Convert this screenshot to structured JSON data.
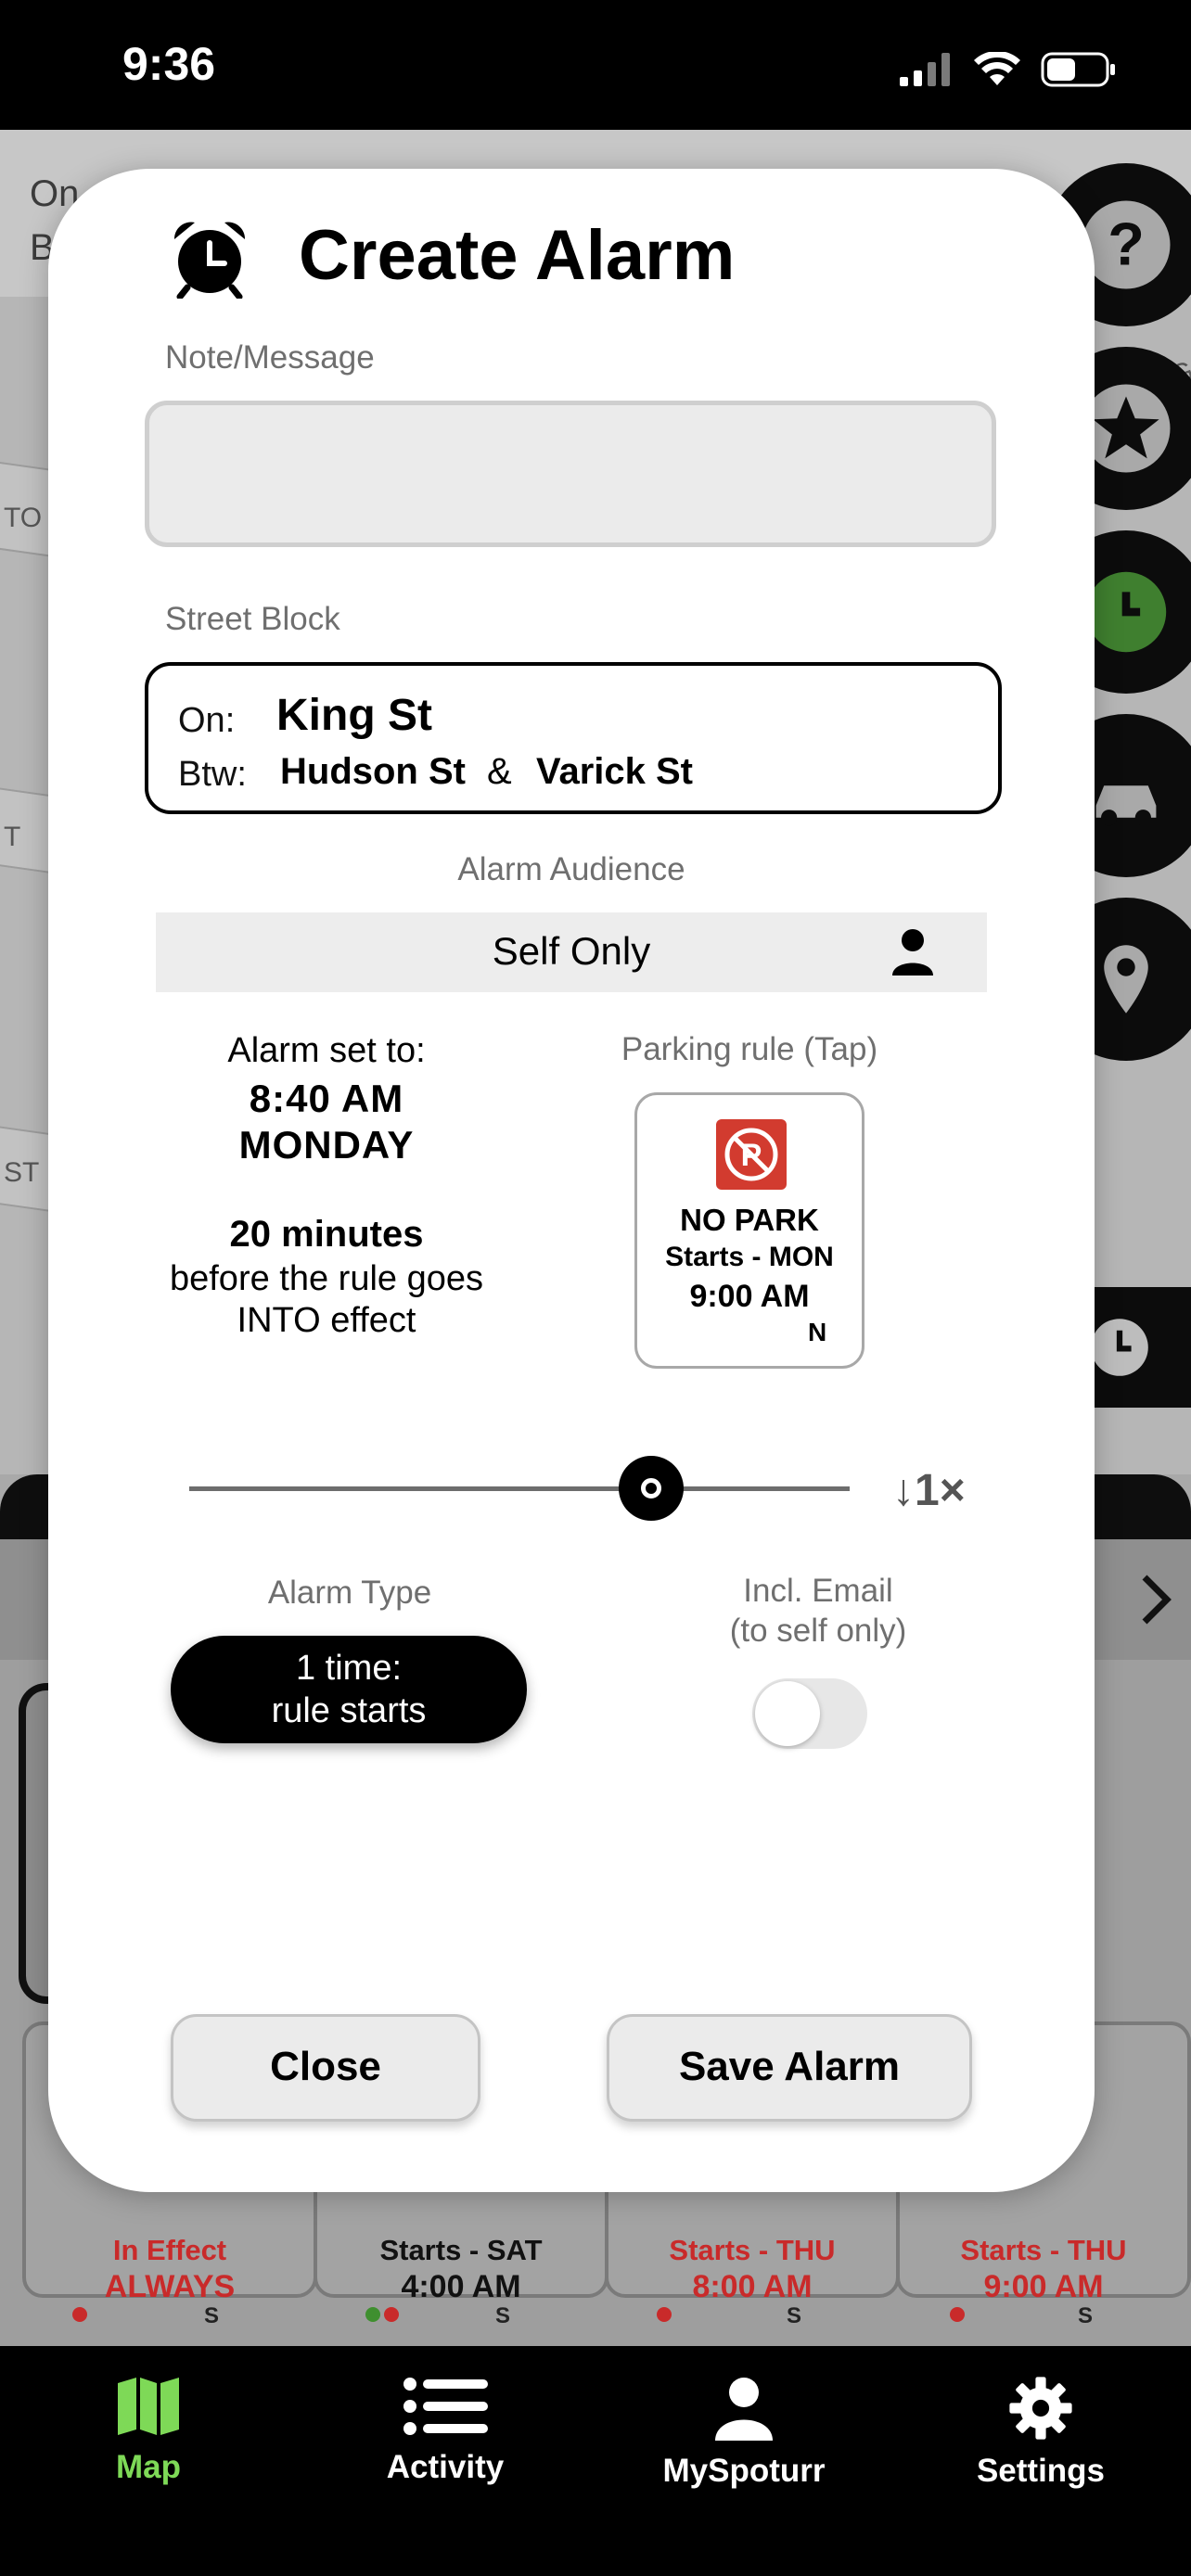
{
  "status_bar": {
    "time": "9:36"
  },
  "background": {
    "top_card_line1": "On",
    "top_card_line2": "B",
    "road_labels": [
      "TO",
      "T",
      "ST",
      "NG"
    ],
    "cards": [
      {
        "line1": "In Effect",
        "line2": "ALWAYS",
        "suffix": "S",
        "color": "#c92a2a"
      },
      {
        "line1": "Starts - SAT",
        "line2": "4:00 AM",
        "suffix": "S",
        "color": "#111111"
      },
      {
        "line1": "Starts - THU",
        "line2": "8:00 AM",
        "suffix": "S",
        "color": "#c92a2a"
      },
      {
        "line1": "Starts - THU",
        "line2": "9:00 AM",
        "suffix": "S",
        "color": "#c92a2a"
      }
    ]
  },
  "modal": {
    "title": "Create Alarm",
    "note_label": "Note/Message",
    "note_value": "",
    "street_label": "Street Block",
    "street": {
      "on_label": "On:",
      "on_value": "King St",
      "btw_label": "Btw:",
      "btw_a": "Hudson St",
      "amp": "&",
      "btw_b": "Varick St"
    },
    "audience_label": "Alarm Audience",
    "audience_value": "Self Only",
    "alarm_set": {
      "label": "Alarm set to:",
      "time": "8:40 AM",
      "day": "MONDAY",
      "offset": "20 minutes",
      "line1": "before the rule goes",
      "line2": "INTO effect"
    },
    "parking_rule_label": "Parking rule (Tap)",
    "parking_rule": {
      "title": "NO PARK",
      "starts": "Starts - MON",
      "time": "9:00 AM",
      "direction": "N"
    },
    "slider": {
      "value": 0.7
    },
    "speed_label": "↓1×",
    "alarm_type_label": "Alarm Type",
    "alarm_type": {
      "line1": "1 time:",
      "line2": "rule starts"
    },
    "email_label_line1": "Incl. Email",
    "email_label_line2": "(to self only)",
    "email_toggle_on": false,
    "close_label": "Close",
    "save_label": "Save Alarm"
  },
  "tab_bar": {
    "accent": "#7ed957",
    "tabs": [
      {
        "label": "Map",
        "icon": "map-icon",
        "active": true
      },
      {
        "label": "Activity",
        "icon": "list-icon",
        "active": false
      },
      {
        "label": "MySpoturr",
        "icon": "person-icon",
        "active": false
      },
      {
        "label": "Settings",
        "icon": "gear-icon",
        "active": false
      }
    ]
  }
}
